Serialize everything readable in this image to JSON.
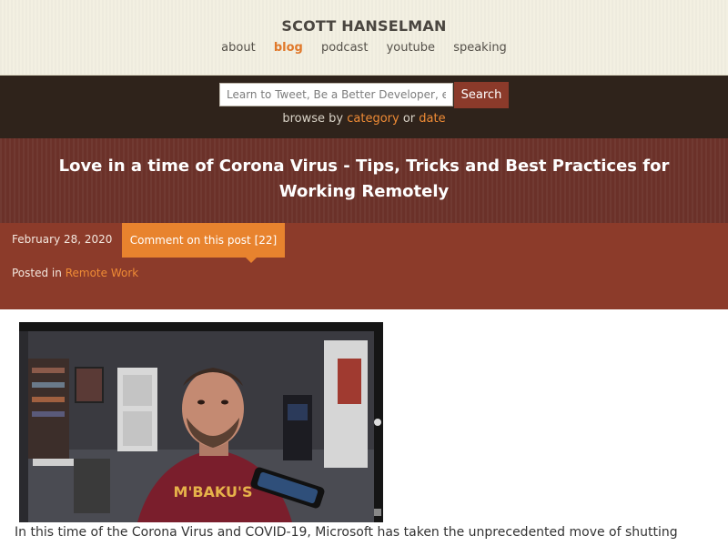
{
  "header": {
    "site_title": "SCOTT HANSELMAN",
    "nav": [
      {
        "label": "about",
        "active": false
      },
      {
        "label": "blog",
        "active": true
      },
      {
        "label": "podcast",
        "active": false
      },
      {
        "label": "youtube",
        "active": false
      },
      {
        "label": "speaking",
        "active": false
      }
    ]
  },
  "search": {
    "placeholder": "Learn to Tweet, Be a Better Developer, e",
    "button_label": "Search",
    "browse_prefix": "browse by",
    "browse_category": "category",
    "browse_or": "or",
    "browse_date": "date"
  },
  "post": {
    "title": "Love in a time of Corona Virus - Tips, Tricks and Best Practices for Working Remotely",
    "date": "February 28, 2020",
    "comment_label": "Comment on this post [22]",
    "posted_in_prefix": "Posted in",
    "category": "Remote Work",
    "body_text": "In this time of the Corona Virus and COVID-19, Microsoft has taken the unprecedented move of shutting",
    "image_shirt_text": "M'BAKU'S"
  },
  "colors": {
    "header_bg": "#f3f0e2",
    "search_band_bg": "#2f231b",
    "title_band_bg": "#6b3129",
    "meta_band_bg": "#8c3b2a",
    "accent_orange": "#e8832e",
    "link_orange": "#ef8b35",
    "search_button_bg": "#8b3a2a"
  },
  "icons": {
    "comment_tail": "speech-bubble-tail"
  }
}
